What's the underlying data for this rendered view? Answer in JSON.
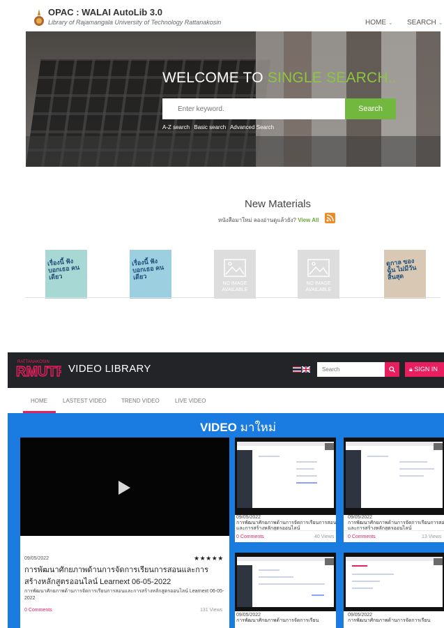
{
  "opac": {
    "title": "OPAC : WALAI AutoLib 3.0",
    "subtitle": "Library of Rajamangala University of Technology Rattanakosin",
    "nav": [
      {
        "label": "HOME"
      },
      {
        "label": "SEARCH"
      }
    ]
  },
  "hero": {
    "welcome": "WELCOME TO ",
    "welcome_highlight": "SINGLE SEARCH..",
    "search_placeholder": "Enter keyword.",
    "search_button": "Search",
    "links": [
      "A-Z search",
      "Basic search",
      "Advanced Search"
    ]
  },
  "new_materials": {
    "title": "New Materials",
    "subtitle": "หนังสือมาใหม่ ลองอ่านดูแล้วยัง?",
    "view_all": "View All",
    "books": [
      {
        "type": "cover",
        "color": "#a8d8d4",
        "text": "เรื่องนี้ ฟังบอกเธอ คนเดียว"
      },
      {
        "type": "cover",
        "color": "#9ccfe0",
        "text": "เรื่องนี้ ฟังบอกเธอ คนเดียว"
      },
      {
        "type": "noimage",
        "text": "NO IMAGE AVAILABLE"
      },
      {
        "type": "noimage",
        "text": "NO IMAGE AVAILABLE"
      },
      {
        "type": "cover",
        "color": "#d8c8b4",
        "text": "ดูกาล ของฉัน ไม่มีวัน สิ้นสุด"
      }
    ]
  },
  "video_library": {
    "logo_top": "RATTANAKOSIN",
    "logo_main": "RMUTR",
    "title": "VIDEO LIBRARY",
    "search_placeholder": "Search",
    "sign_in": "SIGN IN",
    "tabs": [
      "HOME",
      "LASTEST VIDEO",
      "TREND VIDEO",
      "LIVE VIDEO"
    ],
    "heading_bold": "VIDEO",
    "heading_rest": " มาใหม่",
    "featured": {
      "date": "09/05/2022",
      "stars": "★★★★★",
      "title": "การพัฒนาศักยภาพด้านการจัดการเรียนการสอนและการสร้างหลักสูตรออนไลน์ Learnext 06-05-2022",
      "description": "การพัฒนาศักยภาพด้านการจัดการเรียนการสอนและการสร้างหลักสูตรออนไลน์ Learnext 06-05-2022",
      "comments": "0 Comments",
      "views": "131 Views"
    },
    "cards": [
      {
        "date": "09/05/2022",
        "title": "การพัฒนาศักยภาพด้านการจัดการเรียนการสอนและการสร้างหลักสูตรออนไลน์",
        "comments": "0 Comments",
        "views": "40 Views"
      },
      {
        "date": "09/05/2022",
        "title": "การพัฒนาศักยภาพด้านการจัดการเรียนการสอนและการสร้างหลักสูตรออนไลน์",
        "comments": "0 Comments",
        "views": "13 Views"
      },
      {
        "date": "09/05/2022",
        "title": "การพัฒนาศักยภาพด้านการจัดการเรียน",
        "comments": "",
        "views": ""
      },
      {
        "date": "09/05/2022",
        "title": "การพัฒนาศักยภาพด้านการจัดการเรียน",
        "comments": "",
        "views": ""
      }
    ]
  },
  "colors": {
    "accent_green": "#72b83f",
    "accent_pink": "#e81e5f",
    "blue": "#1a7ce0"
  }
}
